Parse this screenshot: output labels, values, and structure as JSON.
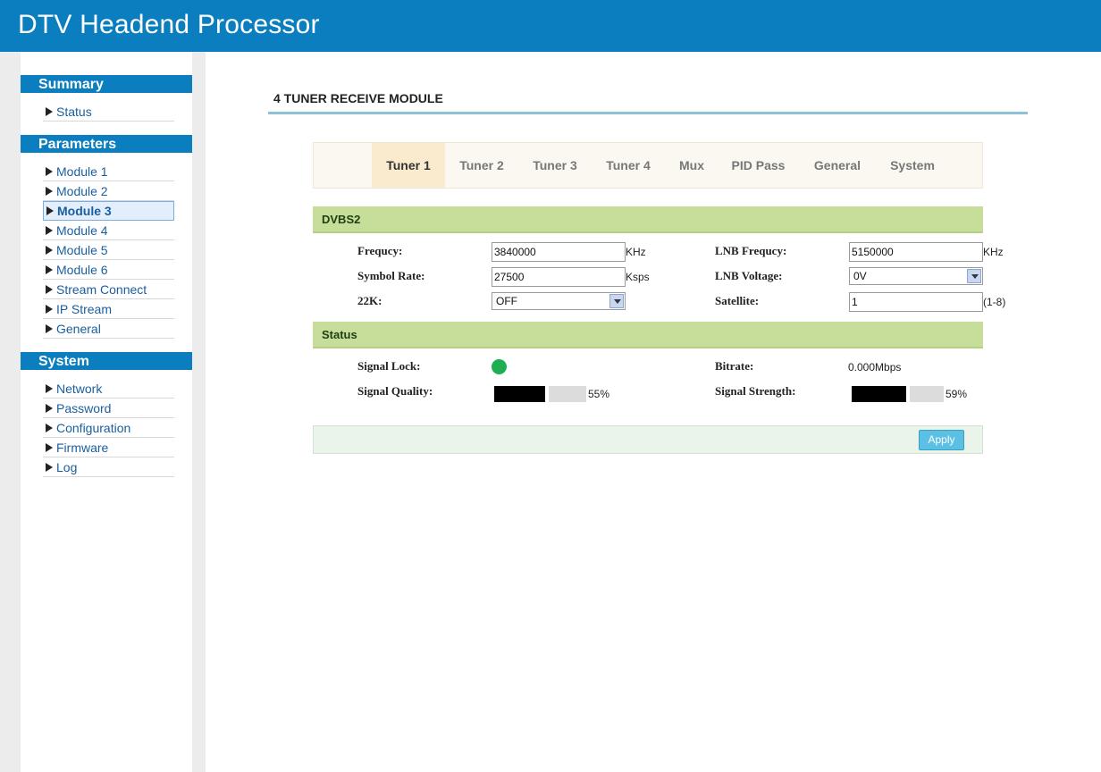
{
  "app": {
    "title": "DTV Headend Processor"
  },
  "sidebar": {
    "sections": [
      {
        "title": "Summary",
        "items": [
          {
            "label": "Status"
          }
        ]
      },
      {
        "title": "Parameters",
        "items": [
          {
            "label": "Module 1"
          },
          {
            "label": "Module 2"
          },
          {
            "label": "Module 3",
            "active": true
          },
          {
            "label": "Module 4"
          },
          {
            "label": "Module 5"
          },
          {
            "label": "Module 6"
          },
          {
            "label": "Stream Connect"
          },
          {
            "label": "IP Stream"
          },
          {
            "label": "General"
          }
        ]
      },
      {
        "title": "System",
        "items": [
          {
            "label": "Network"
          },
          {
            "label": "Password"
          },
          {
            "label": "Configuration"
          },
          {
            "label": "Firmware"
          },
          {
            "label": "Log"
          }
        ]
      }
    ]
  },
  "page": {
    "title": "4 TUNER RECEIVE MODULE"
  },
  "tabs": [
    {
      "label": "Tuner 1",
      "active": true
    },
    {
      "label": "Tuner 2"
    },
    {
      "label": "Tuner 3"
    },
    {
      "label": "Tuner 4"
    },
    {
      "label": "Mux"
    },
    {
      "label": "PID Pass"
    },
    {
      "label": "General"
    },
    {
      "label": "System"
    }
  ],
  "dvbs2": {
    "section_title": "DVBS2",
    "frequency": {
      "label": "Frequcy:",
      "value": "3840000",
      "unit": "KHz"
    },
    "symbol_rate": {
      "label": "Symbol Rate:",
      "value": "27500",
      "unit": "Ksps"
    },
    "k22": {
      "label": "22K:",
      "value": "OFF"
    },
    "lnb_frequency": {
      "label": "LNB Frequcy:",
      "value": "5150000",
      "unit": "KHz"
    },
    "lnb_voltage": {
      "label": "LNB Voltage:",
      "value": "0V"
    },
    "satellite": {
      "label": "Satellite:",
      "value": "1",
      "unit": "(1-8)"
    }
  },
  "status": {
    "section_title": "Status",
    "signal_lock": {
      "label": "Signal Lock:",
      "state": "locked",
      "color": "#1fae52"
    },
    "signal_quality": {
      "label": "Signal Quality:",
      "value": "55%",
      "level": 0.55
    },
    "bitrate": {
      "label": "Bitrate:",
      "value": "0.000Mbps"
    },
    "signal_strength": {
      "label": "Signal Strength:",
      "value": "59%",
      "level": 0.59
    }
  },
  "actions": {
    "apply_label": "Apply"
  },
  "colors": {
    "accent": "#0a7ebf",
    "section_band": "#c7de9b",
    "active_tab": "#faebcf",
    "apply_button": "#5bc0e4"
  }
}
